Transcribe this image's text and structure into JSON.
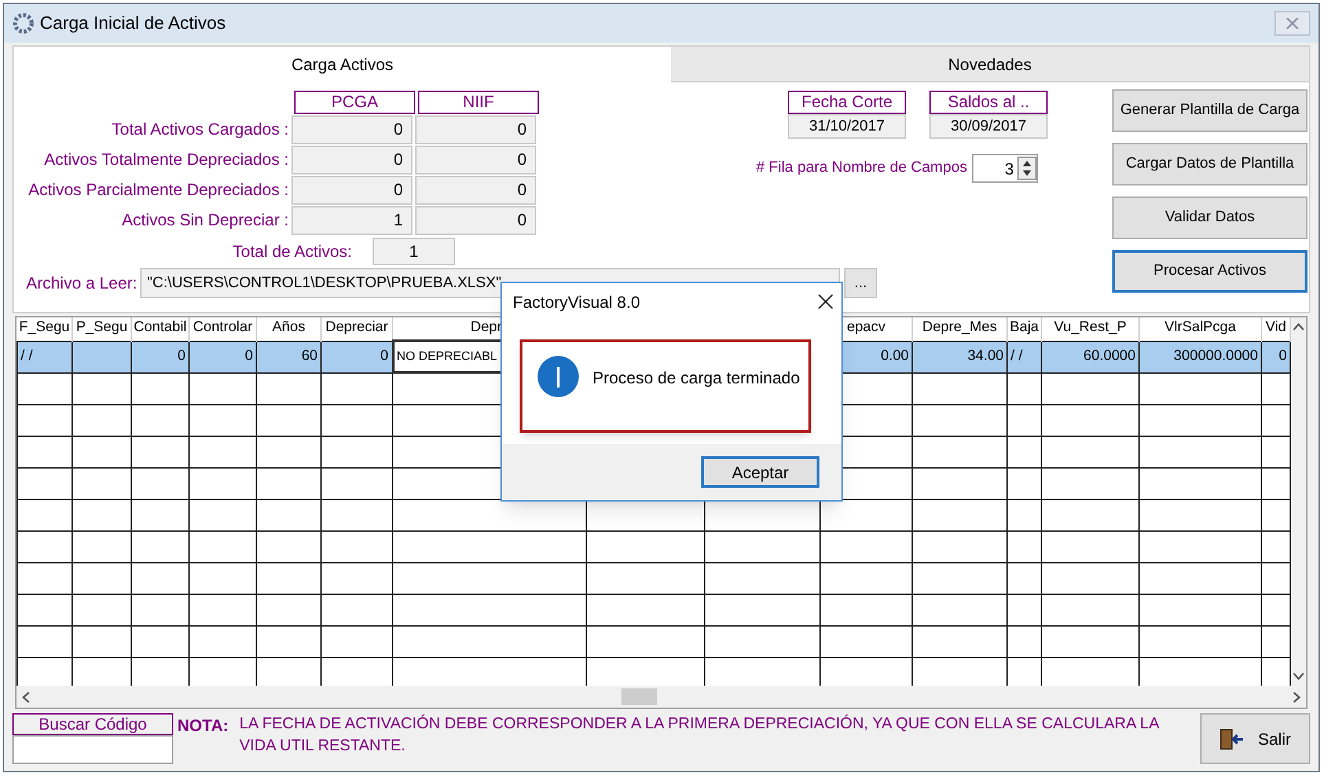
{
  "window": {
    "title": "Carga Inicial de Activos"
  },
  "tabs": [
    {
      "label": "Carga Activos",
      "selected": true
    },
    {
      "label": "Novedades",
      "selected": false
    }
  ],
  "summary": {
    "columns": [
      "PCGA",
      "NIIF"
    ],
    "rows": [
      {
        "label": "Total  Activos Cargados :",
        "values": [
          "0",
          "0"
        ]
      },
      {
        "label": "Activos Totalmente Depreciados :",
        "values": [
          "0",
          "0"
        ]
      },
      {
        "label": "Activos Parcialmente  Depreciados :",
        "values": [
          "0",
          "0"
        ]
      },
      {
        "label": "Activos Sin Depreciar :",
        "values": [
          "1",
          "0"
        ]
      }
    ],
    "total_label": "Total de Activos:",
    "total_value": "1"
  },
  "file": {
    "label": "Archivo a Leer:",
    "value": "\"C:\\USERS\\CONTROL1\\DESKTOP\\PRUEBA.XLSX\"",
    "browse": "..."
  },
  "dates": [
    {
      "label": "Fecha Corte",
      "value": "31/10/2017"
    },
    {
      "label": "Saldos al ..",
      "value": "30/09/2017"
    }
  ],
  "header_row": {
    "label": "# Fila para Nombre de Campos",
    "value": "3"
  },
  "actions": [
    {
      "label": "Generar Plantilla de Carga",
      "focused": false
    },
    {
      "label": "Cargar Datos de Plantilla",
      "focused": false
    },
    {
      "label": "Validar Datos",
      "focused": false
    },
    {
      "label": "Procesar Activos",
      "focused": true
    }
  ],
  "table": {
    "columns": [
      {
        "label": "F_Segu"
      },
      {
        "label": "P_Segu"
      },
      {
        "label": "Contabil"
      },
      {
        "label": "Controlar"
      },
      {
        "label": "Años"
      },
      {
        "label": "Depreciar"
      },
      {
        "label": "Depr"
      },
      {},
      {},
      {
        "label": "epacv"
      },
      {
        "label": "Depre_Mes"
      },
      {
        "label": "Baja"
      },
      {
        "label": "Vu_Rest_P"
      },
      {
        "label": "VlrSalPcga"
      },
      {
        "label": "Vid"
      }
    ],
    "rows": [
      {
        "selected": true,
        "cells": [
          "/ /",
          null,
          "0",
          "0",
          "60",
          "0",
          "NO DEPRECIABL",
          null,
          null,
          "0.00",
          "34.00",
          "/ /",
          "60.0000",
          "300000.0000",
          "0"
        ]
      }
    ]
  },
  "search": {
    "label": "Buscar Código"
  },
  "note": {
    "label": "NOTA:",
    "text": "LA FECHA DE ACTIVACIÓN DEBE CORRESPONDER A LA PRIMERA DEPRECIACIÓN, YA QUE CON ELLA SE CALCULARA LA VIDA UTIL RESTANTE."
  },
  "exit_button": "Salir",
  "dialog": {
    "title": "FactoryVisual 8.0",
    "message": "Proceso de carga terminado",
    "button": "Aceptar"
  }
}
